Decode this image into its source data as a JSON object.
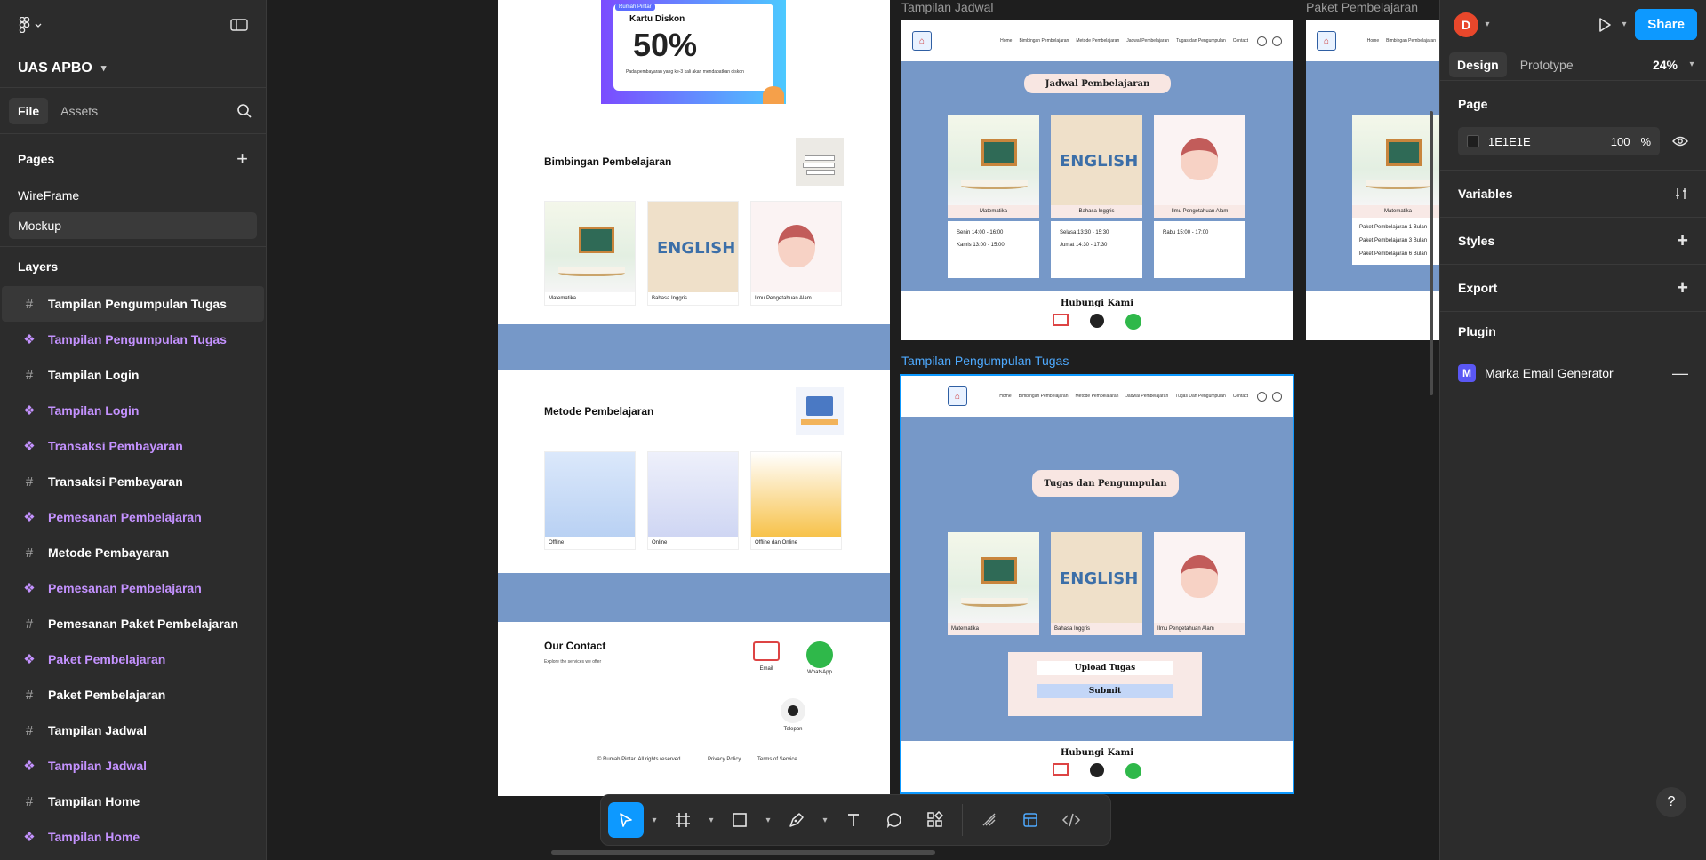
{
  "app": {
    "project_name": "UAS APBO"
  },
  "left_panel": {
    "tabs": [
      "File",
      "Assets"
    ],
    "pages_title": "Pages",
    "pages": [
      "WireFrame",
      "Mockup"
    ],
    "layers_title": "Layers",
    "layers": [
      {
        "name": "Tampilan Pengumpulan Tugas",
        "type": "frame"
      },
      {
        "name": "Tampilan Pengumpulan Tugas",
        "type": "component"
      },
      {
        "name": "Tampilan Login",
        "type": "frame"
      },
      {
        "name": "Tampilan Login",
        "type": "component"
      },
      {
        "name": "Transaksi Pembayaran",
        "type": "component"
      },
      {
        "name": "Transaksi Pembayaran",
        "type": "frame"
      },
      {
        "name": "Pemesanan Pembelajaran",
        "type": "component"
      },
      {
        "name": "Metode Pembayaran",
        "type": "frame"
      },
      {
        "name": "Pemesanan Pembelajaran",
        "type": "component"
      },
      {
        "name": "Pemesanan Paket Pembelajaran",
        "type": "frame"
      },
      {
        "name": "Paket Pembelajaran",
        "type": "component"
      },
      {
        "name": "Paket Pembelajaran",
        "type": "frame"
      },
      {
        "name": "Tampilan Jadwal",
        "type": "frame"
      },
      {
        "name": "Tampilan Jadwal",
        "type": "component"
      },
      {
        "name": "Tampilan Home",
        "type": "frame"
      },
      {
        "name": "Tampilan Home",
        "type": "component"
      }
    ]
  },
  "right_panel": {
    "avatar_letter": "D",
    "share_label": "Share",
    "tabs": [
      "Design",
      "Prototype"
    ],
    "zoom": "24%",
    "page_title": "Page",
    "page_color": "1E1E1E",
    "page_opacity": "100",
    "percent_sign": "%",
    "variables_label": "Variables",
    "styles_label": "Styles",
    "export_label": "Export",
    "plugin_title": "Plugin",
    "plugin_name": "Marka Email Generator",
    "plugin_icon_letter": "M",
    "help": "?"
  },
  "canvas": {
    "frame_labels": {
      "jadwal": "Tampilan Jadwal",
      "paket": "Paket Pembelajaran",
      "tugas": "Tampilan Pengumpulan Tugas"
    },
    "home": {
      "promo_badge": "Rumah Pintar",
      "promo_title": "Kartu Diskon",
      "promo_value": "50%",
      "promo_note": "Pada pembayaran yang ke-3 kali akan mendapatkan diskon",
      "bimbingan_title": "Bimbingan Pembelajaran",
      "subjects": [
        "Matematika",
        "Bahasa Inggris",
        "Ilmu Pengetahuan Alam"
      ],
      "metode_title": "Metode Pembelajaran",
      "methods": [
        "Offline",
        "Online",
        "Offline dan Online"
      ],
      "contact_title": "Our Contact",
      "contact_sub": "Explore the services we offer",
      "contact_items": [
        "Email",
        "WhatsApp",
        "Telepon"
      ],
      "copyright": "© Rumah Pintar. All rights reserved.",
      "privacy": "Privacy Policy",
      "terms": "Terms of Service"
    },
    "nav_links": [
      "Home",
      "Bimbingan Pembelajaran",
      "Metode Pembelajaran",
      "Jadwal Pembelajaran",
      "Tugas dan Pengumpulan",
      "Contact"
    ],
    "jadwal": {
      "title": "Jadwal Pembelajaran",
      "subjects": [
        "Matematika",
        "Bahasa Inggris",
        "Ilmu Pengetahuan Alam"
      ],
      "schedules": [
        [
          "Senin   14:00 - 16:00",
          "Kamis   13:00 - 15:00"
        ],
        [
          "Selasa   13:30 - 15:30",
          "Jumat   14:30 - 17:30"
        ],
        [
          "Rabu   15:00 - 17:00"
        ]
      ],
      "footer_title": "Hubungi Kami"
    },
    "paket": {
      "subject": "Matematika",
      "packages": [
        "Paket Pembelajaran 1 Bulan",
        "Paket Pembelajaran 3 Bulan",
        "Paket Pembelajaran 6 Bulan"
      ]
    },
    "tugas": {
      "nav_links": [
        "Home",
        "Bimbingan Pembelajaran",
        "Metode Pembelajaran",
        "Jadwal Pembelajaran",
        "Tugas Dan Pengumpulan",
        "Contact"
      ],
      "title": "Tugas dan Pengumpulan",
      "subjects": [
        "Matematika",
        "Bahasa Inggris",
        "Ilmu Pengetahuan Alam"
      ],
      "upload_label": "Upload Tugas",
      "submit_label": "Submit",
      "footer_title": "Hubungi Kami"
    }
  },
  "toolbar": {
    "tools": [
      "move-tool",
      "frame-tool",
      "shape-tool",
      "pen-tool",
      "text-tool",
      "comment-tool",
      "actions-tool",
      "draw-mode",
      "design-mode",
      "dev-mode"
    ]
  }
}
